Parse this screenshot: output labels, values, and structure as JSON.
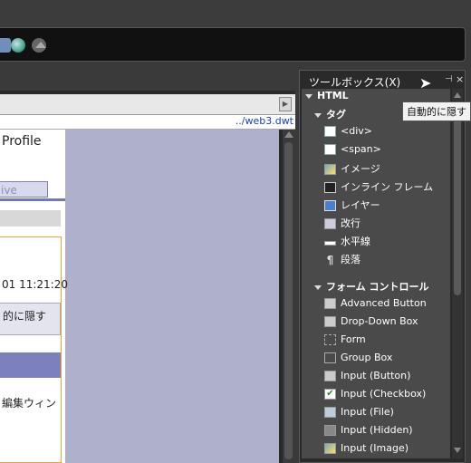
{
  "editor": {
    "url": "../web3.dwt",
    "profile_text": "Profile",
    "tab_live": "ive",
    "datetime": "01 11:21:20",
    "hide_button": "的に隠す",
    "edit_window": "編集ウィン"
  },
  "toolbox": {
    "title": "ツールボックス(X)",
    "pin_icon": "pin-icon",
    "close_label": "×",
    "tooltip": "自動的に隠す",
    "sections": {
      "html": "HTML",
      "tags": "タグ",
      "form_controls": "フォーム コントロール"
    },
    "tag_items": [
      "<div>",
      "<span>",
      "イメージ",
      "インライン フレーム",
      "レイヤー",
      "改行",
      "水平線",
      "段落"
    ],
    "form_items": [
      "Advanced Button",
      "Drop-Down Box",
      "Form",
      "Group Box",
      "Input (Button)",
      "Input (Checkbox)",
      "Input (File)",
      "Input (Hidden)",
      "Input (Image)"
    ]
  }
}
